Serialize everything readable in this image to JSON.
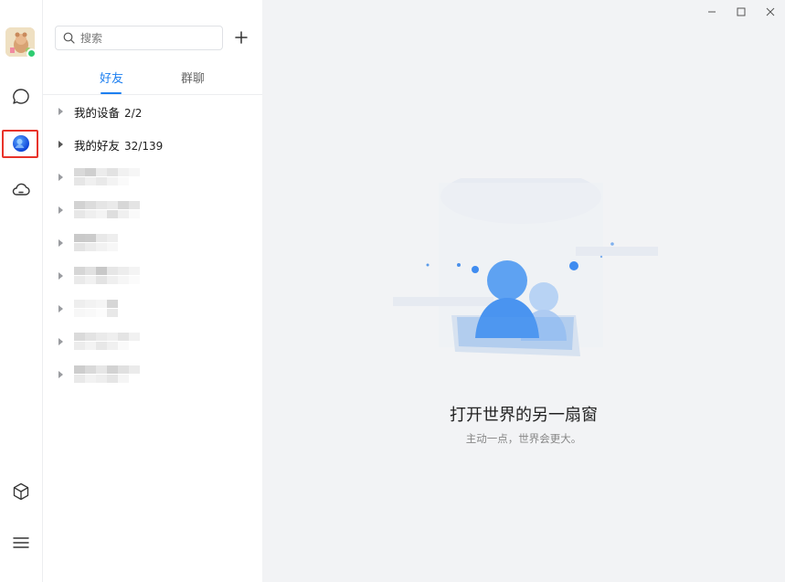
{
  "rail": {
    "items": [
      {
        "name": "messages",
        "icon": "chat-bubble-icon"
      },
      {
        "name": "contacts",
        "icon": "contacts-icon",
        "active": true
      },
      {
        "name": "cloud",
        "icon": "cloud-icon"
      }
    ],
    "bottom": [
      {
        "name": "apps",
        "icon": "cube-icon"
      },
      {
        "name": "menu",
        "icon": "hamburger-menu-icon"
      }
    ],
    "status": "online"
  },
  "search": {
    "placeholder": "搜索"
  },
  "tabs": [
    {
      "label": "好友",
      "active": true
    },
    {
      "label": "群聊",
      "active": false
    }
  ],
  "groups": [
    {
      "label": "我的设备",
      "count": "2/2"
    },
    {
      "label": "我的好友",
      "count": "32/139"
    }
  ],
  "empty_state": {
    "title": "打开世界的另一扇窗",
    "subtitle": "主动一点，世界会更大。"
  },
  "colors": {
    "accent": "#1d7ff0",
    "highlight_frame": "#e8332a",
    "main_bg": "#f2f3f5",
    "online": "#2ecc71"
  }
}
